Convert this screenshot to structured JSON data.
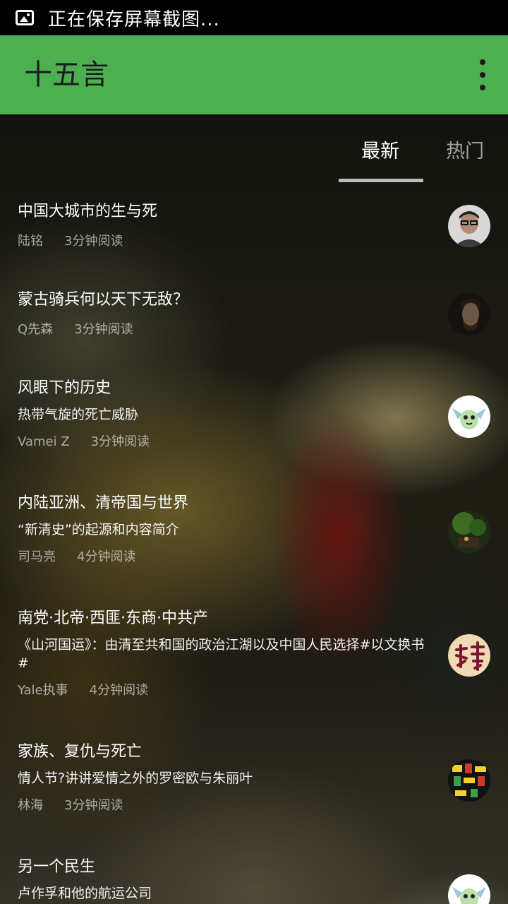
{
  "status_bar": {
    "text": "正在保存屏幕截图..."
  },
  "app_bar": {
    "title": "十五言"
  },
  "tabs": [
    {
      "label": "最新"
    },
    {
      "label": "热门"
    }
  ],
  "articles": [
    {
      "title": "中国大城市的生与死",
      "subtitle": "",
      "author": "陆铭",
      "read_time": "3分钟阅读"
    },
    {
      "title": "蒙古骑兵何以天下无敌？",
      "subtitle": "",
      "author": "Q先森",
      "read_time": "3分钟阅读"
    },
    {
      "title": "风眼下的历史",
      "subtitle": "热带气旋的死亡威胁",
      "author": "Vamei Z",
      "read_time": "3分钟阅读"
    },
    {
      "title": "内陆亚洲、清帝国与世界",
      "subtitle": "“新清史”的起源和内容简介",
      "author": "司马亮",
      "read_time": "4分钟阅读"
    },
    {
      "title": "南党·北帝·西匪·东商·中共产",
      "subtitle": "《山河国运》：由清至共和国的政治江湖以及中国人民选择#以文换书#",
      "author": "Yale执事",
      "read_time": "4分钟阅读"
    },
    {
      "title": "家族、复仇与死亡",
      "subtitle": "情人节?讲讲爱情之外的罗密欧与朱丽叶",
      "author": "林海",
      "read_time": "3分钟阅读"
    },
    {
      "title": "另一个民生",
      "subtitle": "卢作孚和他的航运公司",
      "author": "",
      "read_time": ""
    }
  ]
}
